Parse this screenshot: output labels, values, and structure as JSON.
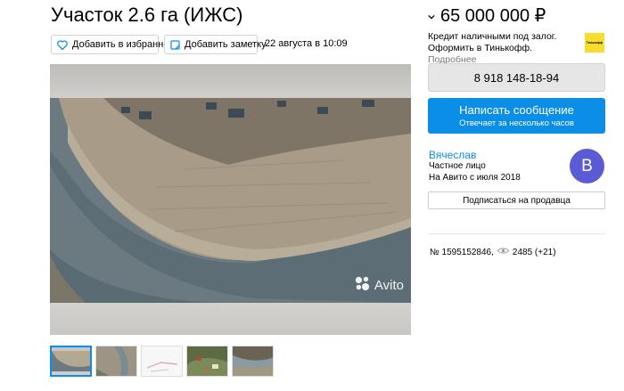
{
  "listing": {
    "title": "Участок 2.6 га (ИЖС)",
    "favorite_label": "Добавить в избранное",
    "note_label": "Добавить заметку",
    "date": "22 августа в 10:09"
  },
  "price": {
    "value": "65 000 000 ₽"
  },
  "credit": {
    "line1": "Кредит наличными под залог.",
    "line2": "Оформить в Тинькофф.",
    "more": "Подробнее",
    "logo_text": "Тинькофф"
  },
  "contact": {
    "phone": "8 918 148-18-94",
    "message_label": "Написать сообщение",
    "message_sub": "Отвечает за несколько часов"
  },
  "seller": {
    "name": "Вячеслав",
    "type": "Частное лицо",
    "since": "На Авито с июля 2018",
    "avatar_letter": "В",
    "subscribe_label": "Подписаться на продавца"
  },
  "stats": {
    "item_id": "№ 1595152846,",
    "views": "2485 (+21)"
  },
  "gallery": {
    "watermark": "Avito",
    "thumbnail_count": 5
  },
  "colors": {
    "accent": "#0a8ee8",
    "avatar": "#5b5bd6",
    "tinkoff": "#f9dc2e"
  }
}
